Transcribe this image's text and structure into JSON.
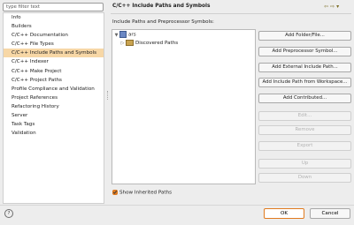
{
  "filter": {
    "placeholder": "type filter text"
  },
  "nav": {
    "items": [
      {
        "label": "Info"
      },
      {
        "label": "Builders"
      },
      {
        "label": "C/C++ Documentation"
      },
      {
        "label": "C/C++ File Types"
      },
      {
        "label": "C/C++ Include Paths and Symbols",
        "selected": true
      },
      {
        "label": "C/C++ Indexer"
      },
      {
        "label": "C/C++ Make Project"
      },
      {
        "label": "C/C++ Project Paths"
      },
      {
        "label": "Profile Compliance and Validation"
      },
      {
        "label": "Project References"
      },
      {
        "label": "Refactoring History"
      },
      {
        "label": "Server"
      },
      {
        "label": "Task Tags"
      },
      {
        "label": "Validation"
      }
    ]
  },
  "page": {
    "title": "C/C++ Include Paths and Symbols",
    "tree_label": "Include Paths and Preprocessor Symbols:"
  },
  "toolbar": {
    "back_glyph": "⇦",
    "forward_glyph": "⇨",
    "menu_glyph": "▾"
  },
  "tree": {
    "root": {
      "label": "ars",
      "expanded": true
    },
    "children": [
      {
        "label": "Discovered Paths",
        "expanded": false
      }
    ]
  },
  "buttons": [
    {
      "label": "Add Folder/File...",
      "enabled": true
    },
    {
      "label": "Add Preprocessor Symbol...",
      "enabled": true
    },
    {
      "label": "Add External Include Path...",
      "enabled": true
    },
    {
      "label": "Add Include Path from Workspace...",
      "enabled": true
    },
    {
      "label": "Add Contributed...",
      "enabled": true
    },
    {
      "label": "Edit...",
      "enabled": false
    },
    {
      "label": "Remove",
      "enabled": false
    },
    {
      "label": "Export",
      "enabled": false
    },
    {
      "label": "Up",
      "enabled": false
    },
    {
      "label": "Down",
      "enabled": false
    }
  ],
  "show_inherited": {
    "label": "Show Inherited Paths",
    "checked": true
  },
  "footer": {
    "help": "?",
    "ok": "OK",
    "cancel": "Cancel"
  },
  "colors": {
    "selection": "#f7d7a6",
    "accent": "#e07b20"
  }
}
